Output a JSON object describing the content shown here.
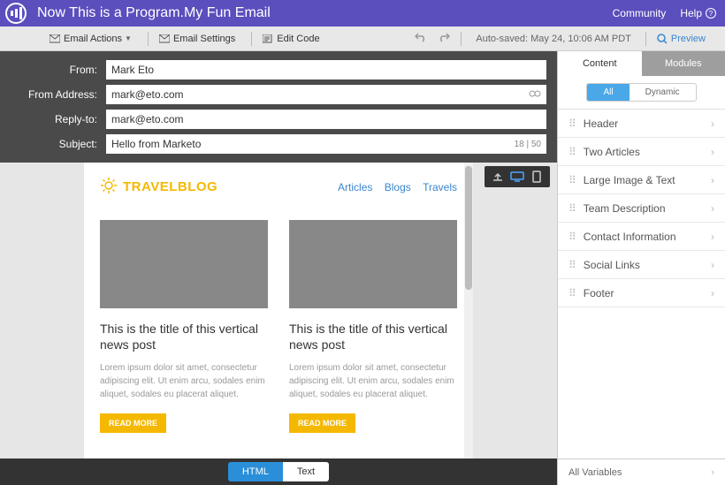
{
  "header": {
    "title": "Now This is a Program.My Fun Email",
    "community": "Community",
    "help": "Help"
  },
  "toolbar": {
    "email_actions": "Email Actions",
    "email_settings": "Email Settings",
    "edit_code": "Edit Code",
    "autosave": "Auto-saved: May 24, 10:06 AM PDT",
    "preview": "Preview"
  },
  "form": {
    "from_label": "From:",
    "from_value": "Mark Eto",
    "from_address_label": "From Address:",
    "from_address_value": "mark@eto.com",
    "reply_to_label": "Reply-to:",
    "reply_to_value": "mark@eto.com",
    "subject_label": "Subject:",
    "subject_value": "Hello from Marketo",
    "subject_count": "18 | 50"
  },
  "canvas": {
    "brand_a": "TRAVEL",
    "brand_b": "BLOG",
    "nav": {
      "articles": "Articles",
      "blogs": "Blogs",
      "travels": "Travels"
    },
    "post_title": "This is the title of this vertical news post",
    "post_body": "Lorem ipsum dolor sit amet, consectetur adipiscing elit. Ut enim arcu, sodales enim aliquet, sodales eu placerat aliquet.",
    "read_more": "READ MORE"
  },
  "footer_toggle": {
    "html": "HTML",
    "text": "Text"
  },
  "right": {
    "tab_content": "Content",
    "tab_modules": "Modules",
    "sub_all": "All",
    "sub_dynamic": "Dynamic",
    "modules": [
      "Header",
      "Two Articles",
      "Large Image & Text",
      "Team Description",
      "Contact Information",
      "Social Links",
      "Footer"
    ],
    "all_variables": "All Variables"
  }
}
